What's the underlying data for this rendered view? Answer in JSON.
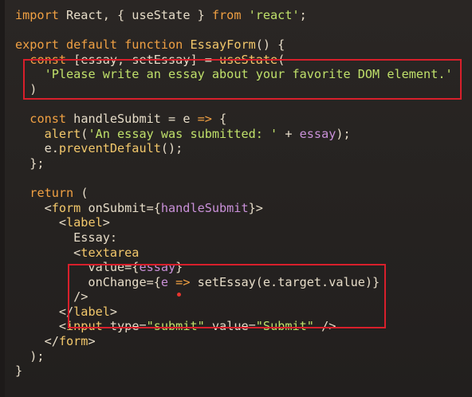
{
  "code": {
    "lines": [
      [
        [
          "kw",
          "import "
        ],
        [
          "plain",
          "React, { useState } "
        ],
        [
          "kw",
          "from "
        ],
        [
          "str",
          "'react'"
        ],
        [
          "plain",
          ";"
        ]
      ],
      [],
      [
        [
          "kw",
          "export default function "
        ],
        [
          "fn",
          "EssayForm"
        ],
        [
          "plain",
          "() {"
        ]
      ],
      [
        [
          "plain",
          "  "
        ],
        [
          "kw",
          "const "
        ],
        [
          "plain",
          "[essay, setEssay] = "
        ],
        [
          "fn",
          "useState"
        ],
        [
          "plain",
          "("
        ]
      ],
      [
        [
          "plain",
          "    "
        ],
        [
          "str",
          "'Please write an essay about your favorite DOM element.'"
        ]
      ],
      [
        [
          "plain",
          "  )"
        ]
      ],
      [],
      [
        [
          "plain",
          "  "
        ],
        [
          "kw",
          "const "
        ],
        [
          "plain",
          "handleSubmit = e "
        ],
        [
          "kw",
          "=> "
        ],
        [
          "plain",
          "{"
        ]
      ],
      [
        [
          "plain",
          "    "
        ],
        [
          "fn",
          "alert"
        ],
        [
          "plain",
          "("
        ],
        [
          "str",
          "'An essay was submitted: '"
        ],
        [
          "plain",
          " + "
        ],
        [
          "var",
          "essay"
        ],
        [
          "plain",
          ");"
        ]
      ],
      [
        [
          "plain",
          "    e."
        ],
        [
          "fn",
          "preventDefault"
        ],
        [
          "plain",
          "();"
        ]
      ],
      [
        [
          "plain",
          "  };"
        ]
      ],
      [],
      [
        [
          "plain",
          "  "
        ],
        [
          "kw",
          "return "
        ],
        [
          "plain",
          "("
        ]
      ],
      [
        [
          "plain",
          "    <"
        ],
        [
          "tag",
          "form "
        ],
        [
          "plain",
          "onSubmit={"
        ],
        [
          "var",
          "handleSubmit"
        ],
        [
          "plain",
          "}>"
        ]
      ],
      [
        [
          "plain",
          "      <"
        ],
        [
          "tag",
          "label"
        ],
        [
          "plain",
          ">"
        ]
      ],
      [
        [
          "plain",
          "        Essay:"
        ]
      ],
      [
        [
          "plain",
          "        <"
        ],
        [
          "tag",
          "textarea"
        ]
      ],
      [
        [
          "plain",
          "          value={"
        ],
        [
          "var",
          "essay"
        ],
        [
          "plain",
          "}"
        ]
      ],
      [
        [
          "plain",
          "          onChange={"
        ],
        [
          "var",
          "e "
        ],
        [
          "kw",
          "=> "
        ],
        [
          "plain",
          "setEssay(e.target.value)}"
        ]
      ],
      [
        [
          "plain",
          "        />"
        ]
      ],
      [
        [
          "plain",
          "      </"
        ],
        [
          "tag",
          "label"
        ],
        [
          "plain",
          ">"
        ]
      ],
      [
        [
          "plain",
          "      <"
        ],
        [
          "tag",
          "input "
        ],
        [
          "plain",
          "type="
        ],
        [
          "str",
          "\"submit\" "
        ],
        [
          "plain",
          "value="
        ],
        [
          "str",
          "\"Submit\" "
        ],
        [
          "plain",
          "/>"
        ]
      ],
      [
        [
          "plain",
          "    </"
        ],
        [
          "tag",
          "form"
        ],
        [
          "plain",
          ">"
        ]
      ],
      [
        [
          "plain",
          "  );"
        ]
      ],
      [
        [
          "plain",
          "}"
        ]
      ]
    ]
  },
  "annotations": {
    "box_color": "#d81f2b",
    "dot_color": "#e8352e"
  }
}
